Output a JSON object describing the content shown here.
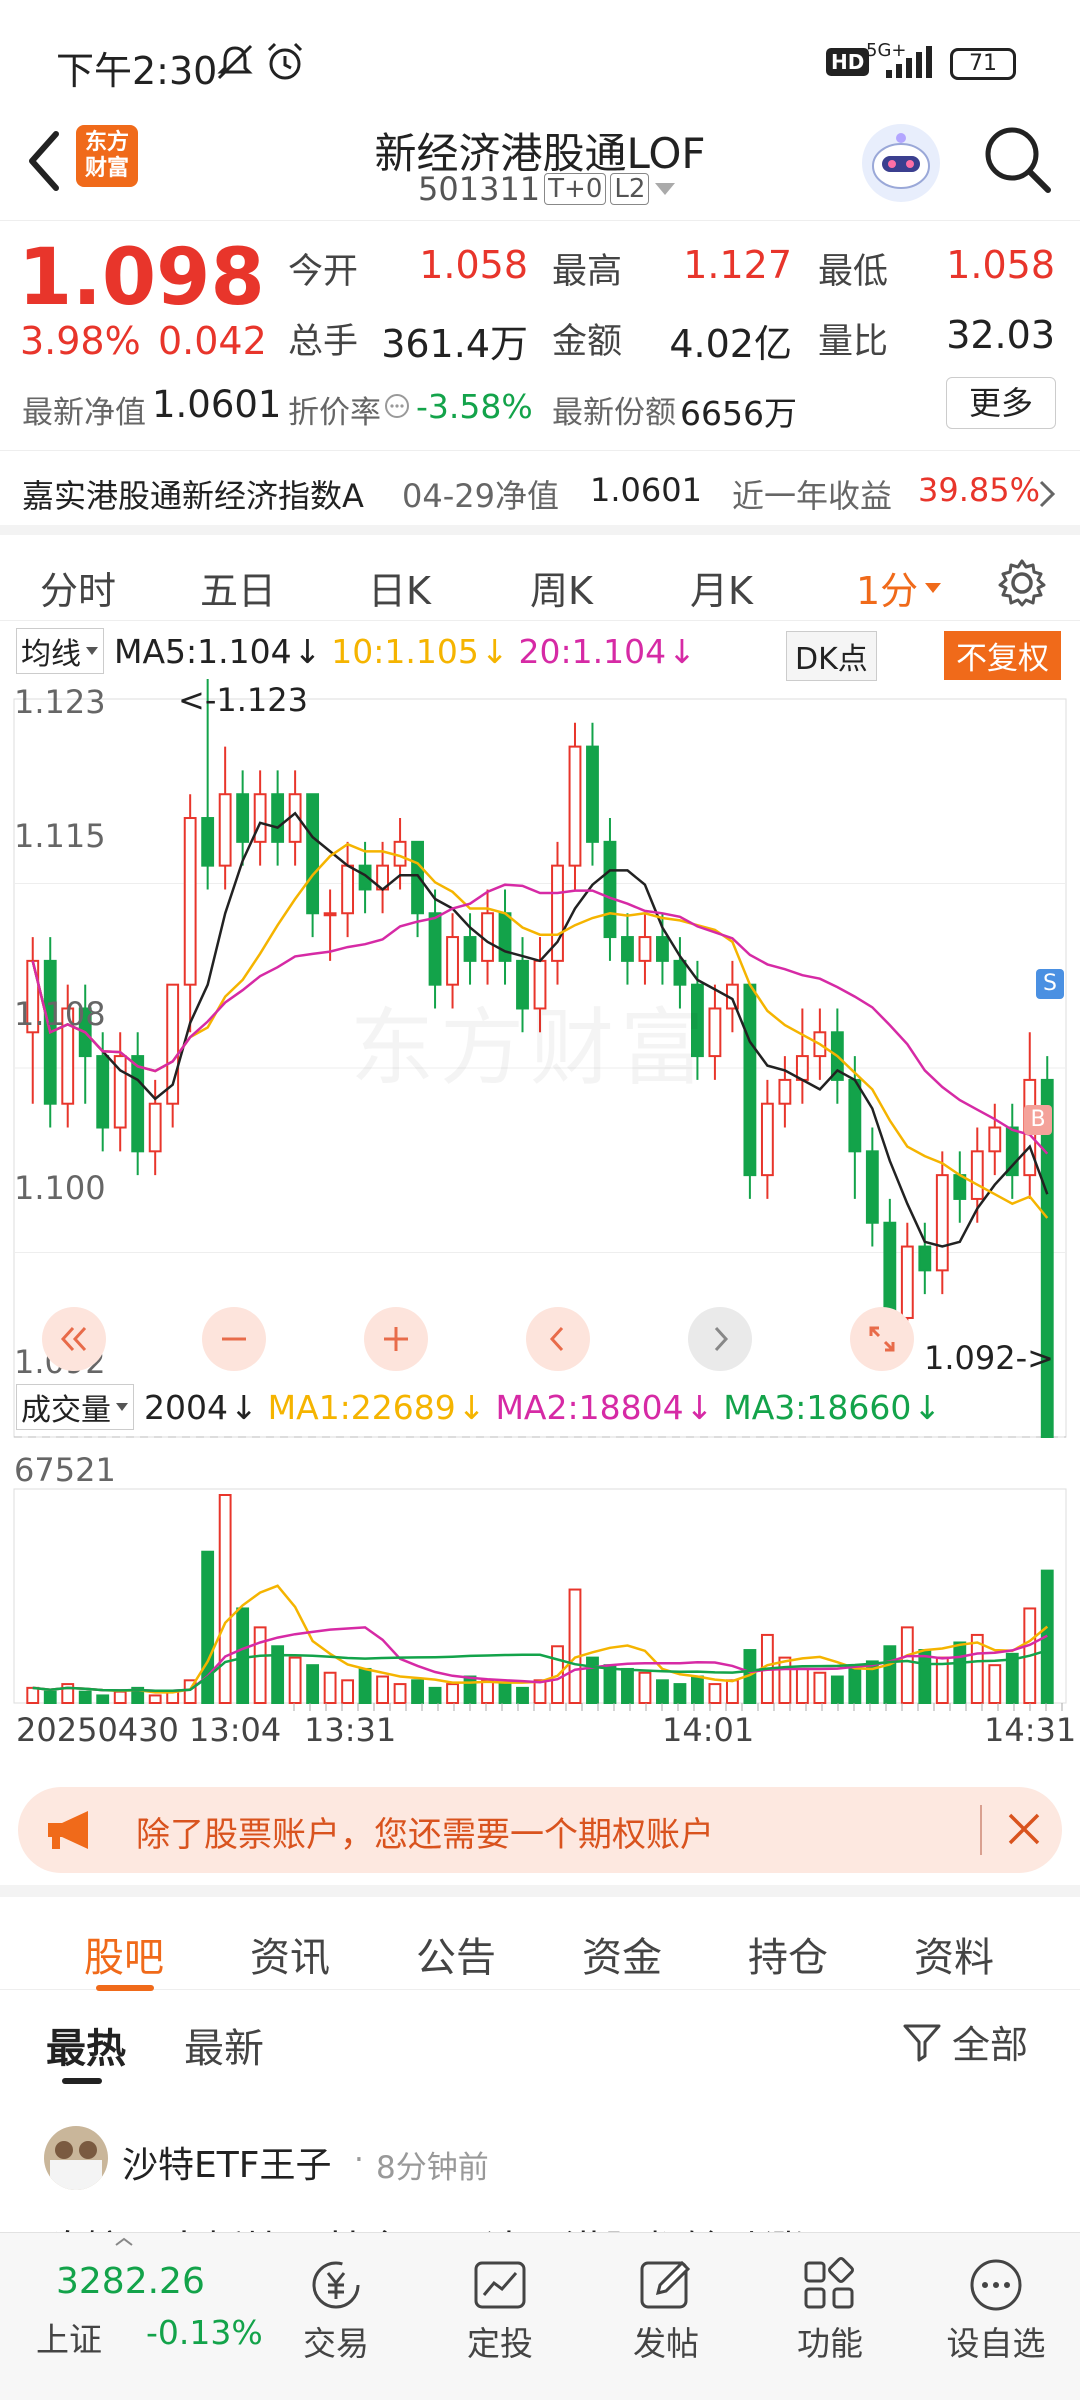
{
  "status_bar": {
    "time": "下午2:30",
    "network": "5G+",
    "battery": "71",
    "hd": "HD"
  },
  "header": {
    "logo_text": "东方\n财富",
    "title": "新经济港股通LOF",
    "code": "501311",
    "badge_t0": "T+0",
    "badge_l2": "L2"
  },
  "quote": {
    "price": "1.098",
    "change_pct": "3.98%",
    "change": "0.042",
    "open_label": "今开",
    "open": "1.058",
    "high_label": "最高",
    "high": "1.127",
    "low_label": "最低",
    "low": "1.058",
    "volume_label": "总手",
    "volume": "361.4万",
    "amount_label": "金额",
    "amount": "4.02亿",
    "ratio_label": "量比",
    "ratio": "32.03",
    "nav_label": "最新净值",
    "nav": "1.0601",
    "discount_label": "折价率",
    "discount": "-3.58%",
    "shares_label": "最新份额",
    "shares": "6656万",
    "more": "更多"
  },
  "index_row": {
    "name": "嘉实港股通新经济指数A",
    "nav_date": "04-29净值",
    "nav": "1.0601",
    "yield_label": "近一年收益",
    "yield": "39.85%"
  },
  "period_tabs": [
    "分时",
    "五日",
    "日K",
    "周K",
    "月K"
  ],
  "period_active": "1分",
  "ma_legend": {
    "selector": "均线",
    "ma5": "MA5:1.104",
    "ma10": "10:1.105",
    "ma20": "20:1.104",
    "dk": "DK点",
    "fq": "不复权"
  },
  "price_axis": [
    "1.123",
    "1.115",
    "1.108",
    "1.100",
    "1.092"
  ],
  "price_annot": {
    "high": "<-1.123",
    "low": "1.092->"
  },
  "bs_marks": {
    "sell": "S",
    "buy": "B"
  },
  "watermark": "东方财富",
  "vol_legend": {
    "selector": "成交量",
    "vol": "2004",
    "ma1": "MA1:22689",
    "ma2": "MA2:18804",
    "ma3": "MA3:18660"
  },
  "vol_axis_max": "67521",
  "time_axis": [
    "20250430 13:04",
    "13:31",
    "14:01",
    "14:31"
  ],
  "colors": {
    "up": "#e8352b",
    "down": "#13a34a",
    "ma5": "#222222",
    "ma10": "#f5b400",
    "ma20": "#d62aa5",
    "accent": "#f06a1a"
  },
  "banner": {
    "text": "除了股票账户，您还需要一个期权账户"
  },
  "content_tabs": [
    "股吧",
    "资讯",
    "公告",
    "资金",
    "持仓",
    "资料"
  ],
  "content_tabs_active": "股吧",
  "sort_tabs": [
    "最热",
    "最新"
  ],
  "filter_label": "全部",
  "post": {
    "user": "沙特ETF王子",
    "time": "8分钟前",
    "preview": "陈婷又大板块，基金，医达，港股都输动涨了"
  },
  "bottom_bar": {
    "index_value": "3282.26",
    "index_name": "上证",
    "index_change": "-0.13%",
    "items": [
      "交易",
      "定投",
      "发帖",
      "功能",
      "设自选"
    ]
  },
  "chart_data": {
    "type": "candlestick",
    "x_start": "20250430 13:04",
    "x_end": "14:31",
    "ylim": [
      1.092,
      1.123
    ],
    "candles": [
      [
        1.109,
        1.112,
        1.113,
        1.106
      ],
      [
        1.112,
        1.106,
        1.113,
        1.105
      ],
      [
        1.106,
        1.11,
        1.111,
        1.105
      ],
      [
        1.11,
        1.108,
        1.111,
        1.106
      ],
      [
        1.108,
        1.105,
        1.109,
        1.104
      ],
      [
        1.105,
        1.108,
        1.109,
        1.104
      ],
      [
        1.108,
        1.104,
        1.109,
        1.103
      ],
      [
        1.104,
        1.106,
        1.107,
        1.103
      ],
      [
        1.106,
        1.111,
        1.111,
        1.105
      ],
      [
        1.111,
        1.118,
        1.119,
        1.109
      ],
      [
        1.118,
        1.116,
        1.124,
        1.115
      ],
      [
        1.116,
        1.119,
        1.121,
        1.115
      ],
      [
        1.119,
        1.117,
        1.12,
        1.116
      ],
      [
        1.117,
        1.119,
        1.12,
        1.116
      ],
      [
        1.119,
        1.117,
        1.12,
        1.116
      ],
      [
        1.117,
        1.119,
        1.12,
        1.116
      ],
      [
        1.119,
        1.114,
        1.119,
        1.113
      ],
      [
        1.114,
        1.114,
        1.115,
        1.112
      ],
      [
        1.114,
        1.116,
        1.117,
        1.113
      ],
      [
        1.116,
        1.115,
        1.117,
        1.114
      ],
      [
        1.115,
        1.116,
        1.117,
        1.114
      ],
      [
        1.116,
        1.117,
        1.118,
        1.115
      ],
      [
        1.117,
        1.114,
        1.117,
        1.113
      ],
      [
        1.114,
        1.111,
        1.115,
        1.11
      ],
      [
        1.111,
        1.113,
        1.114,
        1.11
      ],
      [
        1.113,
        1.112,
        1.114,
        1.111
      ],
      [
        1.112,
        1.114,
        1.115,
        1.111
      ],
      [
        1.114,
        1.112,
        1.115,
        1.111
      ],
      [
        1.112,
        1.11,
        1.113,
        1.109
      ],
      [
        1.11,
        1.112,
        1.113,
        1.109
      ],
      [
        1.112,
        1.116,
        1.117,
        1.111
      ],
      [
        1.116,
        1.121,
        1.122,
        1.115
      ],
      [
        1.121,
        1.117,
        1.122,
        1.116
      ],
      [
        1.117,
        1.113,
        1.118,
        1.112
      ],
      [
        1.113,
        1.112,
        1.114,
        1.111
      ],
      [
        1.112,
        1.113,
        1.114,
        1.111
      ],
      [
        1.113,
        1.112,
        1.114,
        1.111
      ],
      [
        1.112,
        1.111,
        1.113,
        1.11
      ],
      [
        1.111,
        1.108,
        1.112,
        1.107
      ],
      [
        1.108,
        1.11,
        1.111,
        1.107
      ],
      [
        1.11,
        1.111,
        1.112,
        1.109
      ],
      [
        1.111,
        1.103,
        1.111,
        1.102
      ],
      [
        1.103,
        1.106,
        1.107,
        1.102
      ],
      [
        1.106,
        1.107,
        1.108,
        1.105
      ],
      [
        1.107,
        1.108,
        1.11,
        1.106
      ],
      [
        1.108,
        1.109,
        1.11,
        1.107
      ],
      [
        1.109,
        1.107,
        1.11,
        1.106
      ],
      [
        1.107,
        1.104,
        1.108,
        1.102
      ],
      [
        1.104,
        1.101,
        1.105,
        1.1
      ],
      [
        1.101,
        1.097,
        1.102,
        1.096
      ],
      [
        1.097,
        1.1,
        1.101,
        1.096
      ],
      [
        1.1,
        1.099,
        1.101,
        1.098
      ],
      [
        1.099,
        1.103,
        1.104,
        1.098
      ],
      [
        1.103,
        1.102,
        1.104,
        1.101
      ],
      [
        1.102,
        1.104,
        1.105,
        1.101
      ],
      [
        1.104,
        1.105,
        1.106,
        1.103
      ],
      [
        1.105,
        1.103,
        1.106,
        1.102
      ],
      [
        1.103,
        1.107,
        1.109,
        1.102
      ],
      [
        1.107,
        1.092,
        1.108,
        1.092
      ]
    ],
    "volume": [
      4,
      3,
      5,
      3,
      2,
      3,
      4,
      2,
      3,
      6,
      40,
      55,
      25,
      20,
      15,
      12,
      10,
      8,
      6,
      9,
      7,
      5,
      6,
      4,
      5,
      7,
      6,
      5,
      4,
      6,
      15,
      30,
      12,
      10,
      9,
      8,
      6,
      5,
      7,
      5,
      6,
      14,
      18,
      12,
      9,
      8,
      7,
      10,
      11,
      15,
      20,
      14,
      12,
      16,
      18,
      10,
      13,
      25,
      35
    ],
    "vol_ylim": [
      0,
      67521
    ]
  }
}
